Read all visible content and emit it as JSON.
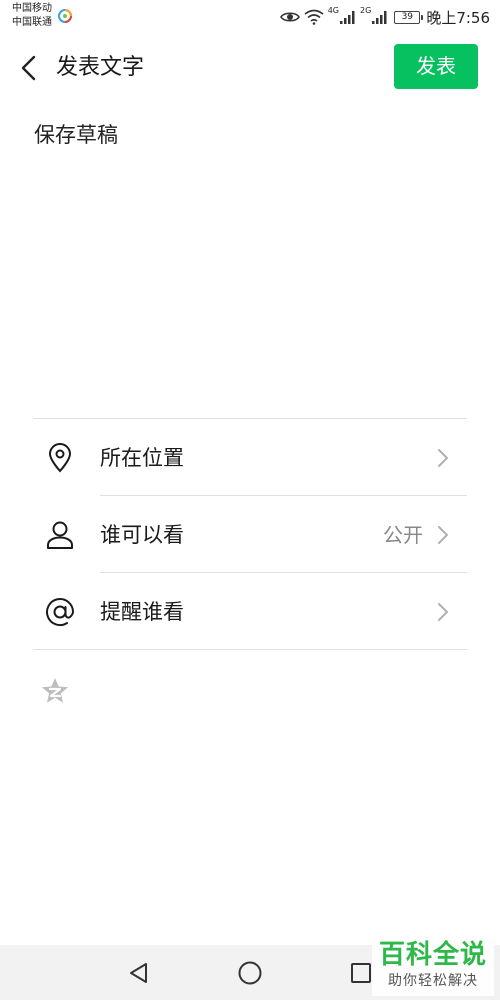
{
  "status_bar": {
    "carrier_1": "中国移动",
    "carrier_2": "中国联通",
    "net_1": "4G",
    "net_2": "2G",
    "battery": "39",
    "time": "晚上7:56"
  },
  "header": {
    "title": "发表文字",
    "publish_label": "发表",
    "publish_color": "#07c160"
  },
  "editor": {
    "text": "保存草稿"
  },
  "options": [
    {
      "label": "所在位置",
      "value": "",
      "icon": "location-pin-icon"
    },
    {
      "label": "谁可以看",
      "value": "公开",
      "icon": "person-icon"
    },
    {
      "label": "提醒谁看",
      "value": "",
      "icon": "at-sign-icon"
    }
  ],
  "extra": {
    "icon": "qzone-star-icon"
  },
  "nav_bar": {
    "icons": [
      "back-triangle-icon",
      "home-circle-icon",
      "recent-square-icon"
    ]
  },
  "watermark": {
    "title": "百科全说",
    "subtitle": "助你轻松解决"
  }
}
